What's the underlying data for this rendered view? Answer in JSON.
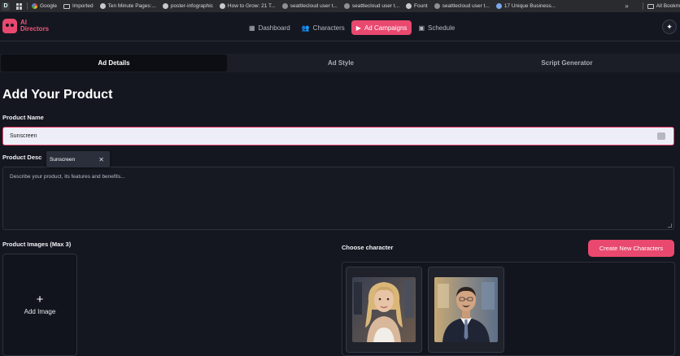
{
  "bookmarks": {
    "profile_initial": "D",
    "items": [
      {
        "label": "Google",
        "icon": "google-icon"
      },
      {
        "label": "Imported",
        "icon": "folder-icon"
      },
      {
        "label": "Ten Minute Pages:...",
        "icon": "site-icon"
      },
      {
        "label": "poster-infographic",
        "icon": "site-icon"
      },
      {
        "label": "How to Grow: 21 T...",
        "icon": "site-icon"
      },
      {
        "label": "seattlecloud user t...",
        "icon": "site-icon"
      },
      {
        "label": "seattlecloud user t...",
        "icon": "site-icon"
      },
      {
        "label": "Fount",
        "icon": "site-icon"
      },
      {
        "label": "seattlecloud user t...",
        "icon": "site-icon"
      },
      {
        "label": "17 Unique Business...",
        "icon": "site-icon"
      }
    ],
    "overflow": "»",
    "all_bookmarks": "All Bookm"
  },
  "app": {
    "logo_line1": "AI",
    "logo_line2": "Directors",
    "nav": [
      {
        "label": "Dashboard",
        "icon": "grid-icon",
        "glyph": "▦",
        "active": false
      },
      {
        "label": "Characters",
        "icon": "users-icon",
        "glyph": "👥",
        "active": false
      },
      {
        "label": "Ad Campaigns",
        "icon": "video-icon",
        "glyph": "▶",
        "active": true
      },
      {
        "label": "Schedule",
        "icon": "calendar-icon",
        "glyph": "▣",
        "active": false
      }
    ],
    "action_glyph": "✦"
  },
  "tabs": [
    "Ad Details",
    "Ad Style",
    "Script Generator"
  ],
  "form": {
    "title": "Add Your Product",
    "product_name_label": "Product Name",
    "product_name_value": "Sunscreen",
    "autocomplete_value": "Sunscreen",
    "autocomplete_close": "✕",
    "description_label": "Product Desc",
    "description_placeholder": "Describe your product, its features and benefits...",
    "images_label": "Product Images (Max 3)",
    "add_image_plus": "+",
    "add_image_label": "Add Image",
    "choose_character_label": "Choose character",
    "create_button": "Create New Characters"
  },
  "colors": {
    "accent": "#e9496f",
    "background": "#141720"
  }
}
